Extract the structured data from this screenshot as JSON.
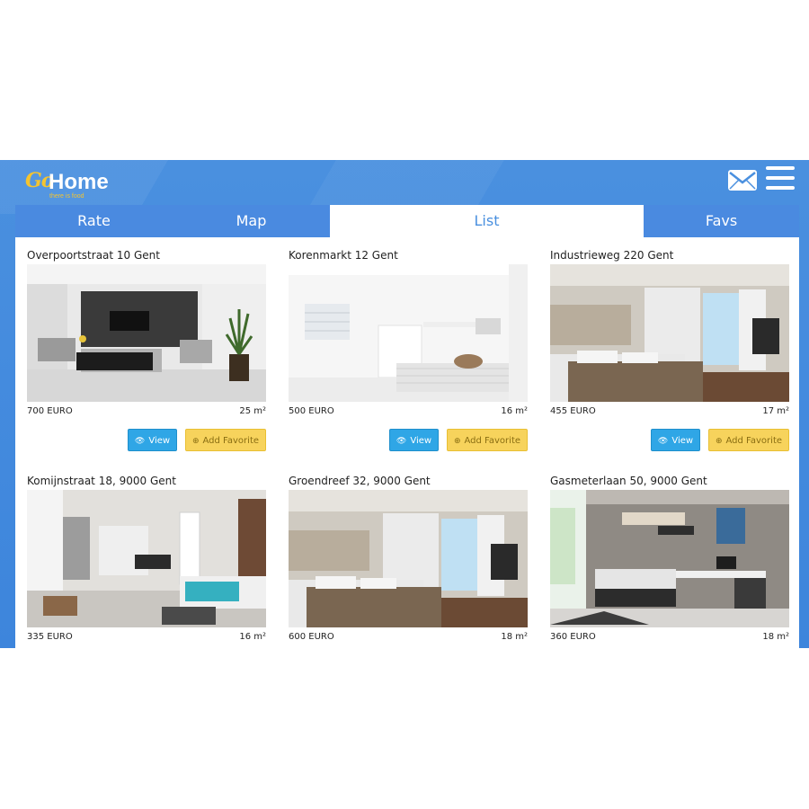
{
  "brand": {
    "logo_go": "Go",
    "logo_home": "Home",
    "tagline": "there is food"
  },
  "header": {
    "mail_icon": "envelope-icon",
    "menu_icon": "hamburger-menu-icon"
  },
  "tabs": [
    {
      "label": "Rate",
      "active": false
    },
    {
      "label": "Map",
      "active": false
    },
    {
      "label": "List",
      "active": true
    },
    {
      "label": "Favs",
      "active": false
    }
  ],
  "colors": {
    "header": "#4a90df",
    "view_button": "#2fa6e6",
    "favorite_button": "#f7d35c",
    "logo_accent": "#f4c430"
  },
  "buttons": {
    "view_label": "View",
    "favorite_label": "Add Favorite",
    "view_icon": "eye-icon",
    "favorite_icon": "plus-circle-icon"
  },
  "listings": [
    {
      "title": "Overpoortstraat 10 Gent",
      "price": "700 EURO",
      "size": "25 m²",
      "photo": "living-room-photo"
    },
    {
      "title": "Korenmarkt 12 Gent",
      "price": "500 EURO",
      "size": "16 m²",
      "photo": "white-bedroom-photo"
    },
    {
      "title": "Industrieweg 220 Gent",
      "price": "455 EURO",
      "size": "17 m²",
      "photo": "hotel-bedroom-photo"
    },
    {
      "title": "Komijnstraat 18, 9000 Gent",
      "price": "335 EURO",
      "size": "16 m²",
      "photo": "loft-bedroom-photo"
    },
    {
      "title": "Groendreef 32, 9000 Gent",
      "price": "600 EURO",
      "size": "18 m²",
      "photo": "hotel-bedroom-photo"
    },
    {
      "title": "Gasmeterlaan 50, 9000 Gent",
      "price": "360 EURO",
      "size": "18 m²",
      "photo": "student-room-photo"
    }
  ]
}
